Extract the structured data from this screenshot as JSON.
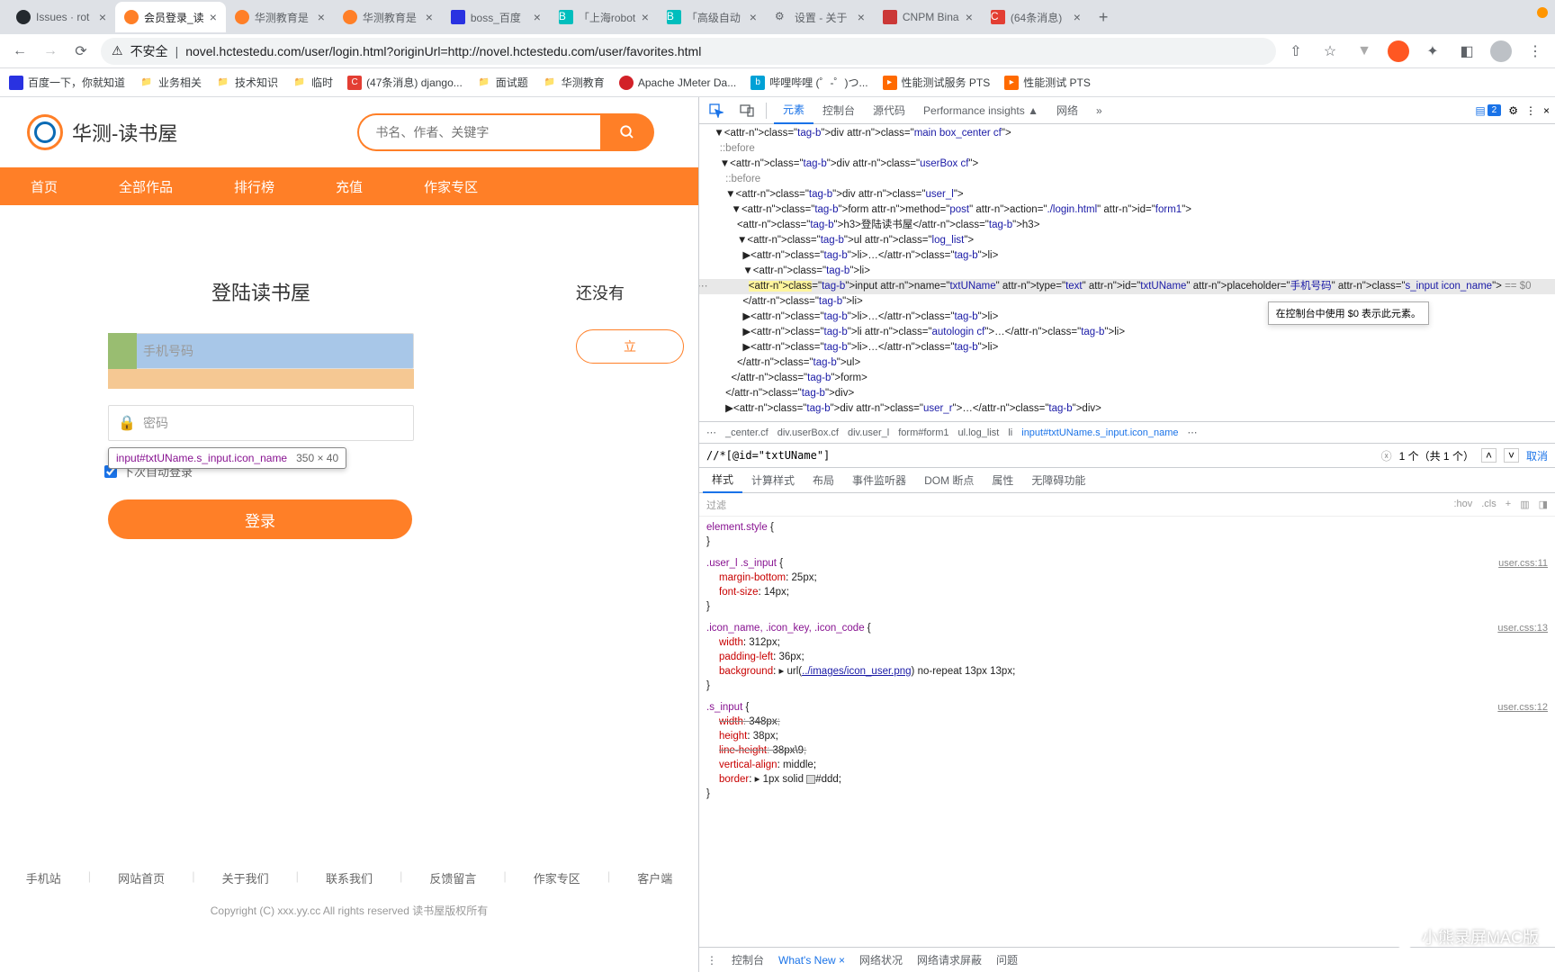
{
  "browser": {
    "tabs": [
      {
        "title": "Issues · rot",
        "favicon": "gh"
      },
      {
        "title": "会员登录_读",
        "favicon": "book",
        "active": true
      },
      {
        "title": "华测教育是",
        "favicon": "book"
      },
      {
        "title": "华测教育是",
        "favicon": "book"
      },
      {
        "title": "boss_百度",
        "favicon": "baidu"
      },
      {
        "title": "「上海robot",
        "favicon": "b"
      },
      {
        "title": "「高级自动",
        "favicon": "b"
      },
      {
        "title": "设置 - 关于",
        "favicon": "gear"
      },
      {
        "title": "CNPM Bina",
        "favicon": "c"
      },
      {
        "title": "(64条消息)",
        "favicon": "c"
      }
    ],
    "insecure_label": "不安全",
    "url": "novel.hctestedu.com/user/login.html?originUrl=http://novel.hctestedu.com/user/favorites.html",
    "bookmarks": [
      "百度一下，你就知道",
      "业务相关",
      "技术知识",
      "临时",
      "(47条消息) django...",
      "面试题",
      "华测教育",
      "Apache JMeter Da...",
      "哔哩哔哩 (゜-゜)つ...",
      "性能测试服务 PTS",
      "性能测试 PTS"
    ]
  },
  "page": {
    "logo_text": "华测-读书屋",
    "search_placeholder": "书名、作者、关键字",
    "nav": [
      "首页",
      "全部作品",
      "排行榜",
      "充值",
      "作家专区"
    ],
    "login_title": "登陆读书屋",
    "phone_placeholder": "手机号码",
    "pwd_placeholder": "密码",
    "autologin_label": "下次自动登录",
    "login_btn": "登录",
    "no_account": "还没有",
    "register_btn": "立",
    "inspect_tooltip_sel": "input#txtUName.s_input.icon_name",
    "inspect_tooltip_dim": "350 × 40",
    "footer_links": [
      "手机站",
      "网站首页",
      "关于我们",
      "联系我们",
      "反馈留言",
      "作家专区",
      "客户端"
    ],
    "footer_copy": "Copyright (C) xxx.yy.cc All rights reserved  读书屋版权所有"
  },
  "devtools": {
    "main_tabs": [
      "元素",
      "控制台",
      "源代码",
      "Performance insights ▲",
      "网络"
    ],
    "main_tabs_more": "»",
    "badge_count": "2",
    "elements_html": [
      {
        "indent": 1,
        "text": "▼<div class=\"main box_center cf\">"
      },
      {
        "indent": 2,
        "text": "::before",
        "pseudo": true
      },
      {
        "indent": 2,
        "text": "▼<div class=\"userBox cf\">"
      },
      {
        "indent": 3,
        "text": "::before",
        "pseudo": true
      },
      {
        "indent": 3,
        "text": "▼<div class=\"user_l\">"
      },
      {
        "indent": 4,
        "text": "▼<form method=\"post\" action=\"./login.html\" id=\"form1\">"
      },
      {
        "indent": 5,
        "text": "<h3>登陆读书屋</h3>"
      },
      {
        "indent": 5,
        "text": "▼<ul class=\"log_list\">"
      },
      {
        "indent": 6,
        "text": "▶<li>…</li>"
      },
      {
        "indent": 6,
        "text": "▼<li>"
      },
      {
        "indent": 7,
        "text": "<input name=\"txtUName\" type=\"text\" id=\"txtUName\" placeholder=\"手机号码\" class=\"s_input icon_name\"> == $0",
        "highlighted": true
      },
      {
        "indent": 6,
        "text": "</li>"
      },
      {
        "indent": 6,
        "text": "▶<li>…</li>"
      },
      {
        "indent": 6,
        "text": "▶<li class=\"autologin cf\">…</li>"
      },
      {
        "indent": 6,
        "text": "▶<li>…</li>"
      },
      {
        "indent": 5,
        "text": "</ul>"
      },
      {
        "indent": 4,
        "text": "</form>"
      },
      {
        "indent": 3,
        "text": "</div>"
      },
      {
        "indent": 3,
        "text": "▶<div class=\"user_r\">…</div>"
      }
    ],
    "tooltip_text": "在控制台中使用 $0 表示此元素。",
    "breadcrumb": [
      "⋯",
      "_center.cf",
      "div.userBox.cf",
      "div.user_l",
      "form#form1",
      "ul.log_list",
      "li",
      "input#txtUName.s_input.icon_name",
      "⋯"
    ],
    "search_value": "//*[@id=\"txtUName\"]",
    "search_result": "1 个（共 1 个）",
    "search_cancel": "取消",
    "styles_tabs": [
      "样式",
      "计算样式",
      "布局",
      "事件监听器",
      "DOM 断点",
      "属性",
      "无障碍功能"
    ],
    "filter_ph": "过滤",
    "filter_right": [
      ":hov",
      ".cls",
      "+"
    ],
    "rules": [
      {
        "selector": "element.style",
        "props": []
      },
      {
        "selector": ".user_l .s_input",
        "link": "user.css:11",
        "props": [
          {
            "n": "margin-bottom",
            "v": "25px"
          },
          {
            "n": "font-size",
            "v": "14px"
          }
        ]
      },
      {
        "selector": ".icon_name, .icon_key, .icon_code",
        "link": "user.css:13",
        "props": [
          {
            "n": "width",
            "v": "312px"
          },
          {
            "n": "padding-left",
            "v": "36px"
          },
          {
            "n": "background",
            "v": "▸ url(../images/icon_user.png) no-repeat 13px 13px",
            "url": true
          }
        ]
      },
      {
        "selector": ".s_input",
        "link": "user.css:12",
        "props": [
          {
            "n": "width",
            "v": "348px",
            "strike": true
          },
          {
            "n": "height",
            "v": "38px"
          },
          {
            "n": "line-height",
            "v": "38px\\9",
            "strike": true
          },
          {
            "n": "vertical-align",
            "v": "middle"
          },
          {
            "n": "border",
            "v": "▸ 1px solid ◻#ddd"
          }
        ]
      }
    ],
    "drawer_tabs": [
      "控制台",
      "What's New",
      "网络状况",
      "网络请求屏蔽",
      "问题"
    ],
    "drawer_active": "What's New"
  },
  "watermark": "小熊录屏MAC版"
}
